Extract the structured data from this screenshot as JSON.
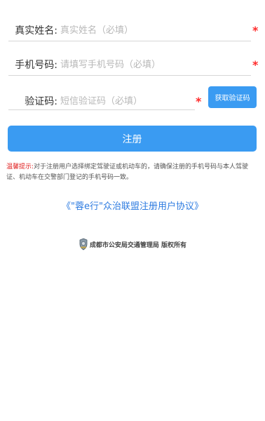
{
  "form": {
    "real_name": {
      "label": "真实姓名:",
      "placeholder": "真实姓名（必填）",
      "value": ""
    },
    "phone": {
      "label": "手机号码:",
      "placeholder": "请填写手机号码（必填）",
      "value": ""
    },
    "code": {
      "label": "验证码:",
      "placeholder": "短信验证码（必填）",
      "value": ""
    },
    "required_mark": "*",
    "get_code_label": "获取验证码",
    "register_label": "注册"
  },
  "notice": {
    "title": "温馨提示:",
    "text": "对于注册用户选择绑定驾驶证或机动车的，请确保注册的手机号码与本人驾驶证、机动车在交警部门登记的手机号码一致。"
  },
  "agreement_link": "《\"蓉e行\"众治联盟注册用户协议》",
  "footer": {
    "text": "成都市公安局交通管理局 版权所有",
    "icon": "police-badge-icon"
  },
  "colors": {
    "primary": "#3a9bf2",
    "required": "#ff2a2a",
    "link": "#2d7be0",
    "notice_title": "#e02020"
  }
}
